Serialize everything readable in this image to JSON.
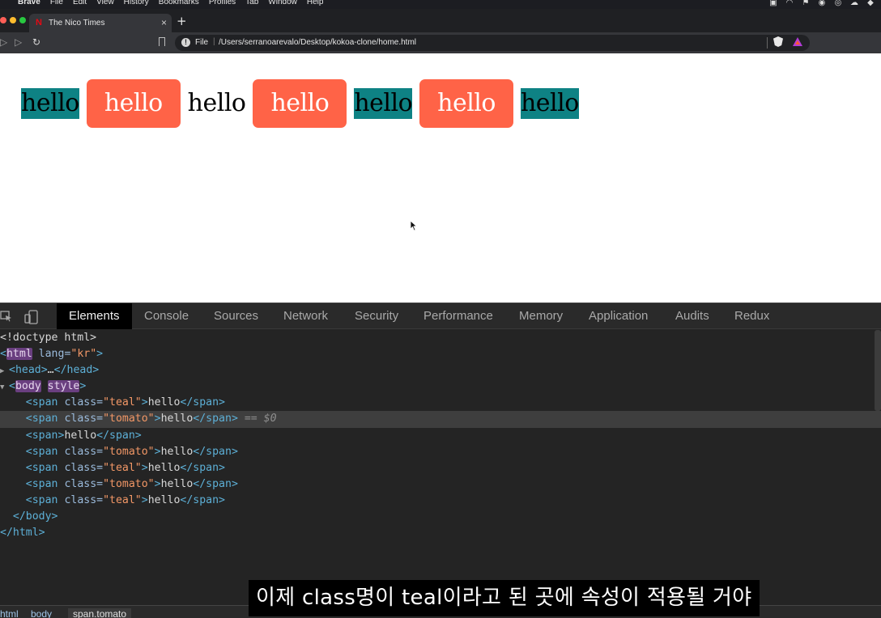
{
  "menubar": {
    "app": "Brave",
    "items": [
      "File",
      "Edit",
      "View",
      "History",
      "Bookmarks",
      "Profiles",
      "Tab",
      "Window",
      "Help"
    ]
  },
  "browser": {
    "tab_title": "The Nico Times",
    "tab_favicon": "N",
    "new_tab": "+",
    "url_scheme": "File",
    "url_path": "/Users/serranoarevalo/Desktop/kokoa-clone/home.html"
  },
  "page": {
    "words": [
      {
        "text": "hello",
        "class": "teal"
      },
      {
        "text": "hello",
        "class": "tomato"
      },
      {
        "text": "hello",
        "class": "plain"
      },
      {
        "text": "hello",
        "class": "tomato"
      },
      {
        "text": "hello",
        "class": "teal"
      },
      {
        "text": "hello",
        "class": "tomato"
      },
      {
        "text": "hello",
        "class": "teal"
      }
    ]
  },
  "devtools": {
    "tabs": [
      "Elements",
      "Console",
      "Sources",
      "Network",
      "Security",
      "Performance",
      "Memory",
      "Application",
      "Audits",
      "Redux"
    ],
    "active_tab": "Elements",
    "dom": {
      "doctype": "<!doctype html>",
      "html_tag": "html",
      "html_attr": "lang",
      "html_val": "\"kr\"",
      "head": "head",
      "head_ellipsis": "…",
      "body_tag": "body",
      "body_attr": "style",
      "span_tag": "span",
      "class_attr": "class",
      "children": [
        {
          "cls": "\"teal\"",
          "text": "hello"
        },
        {
          "cls": "\"tomato\"",
          "text": "hello"
        },
        {
          "cls": "",
          "text": "hello"
        },
        {
          "cls": "\"tomato\"",
          "text": "hello"
        },
        {
          "cls": "\"teal\"",
          "text": "hello"
        },
        {
          "cls": "\"tomato\"",
          "text": "hello"
        },
        {
          "cls": "\"teal\"",
          "text": "hello"
        }
      ],
      "selected_marker": " == $0",
      "body_close": "body",
      "html_close": "html"
    },
    "breadcrumbs": [
      "html",
      "body",
      "span.tomato"
    ]
  },
  "subtitle": "이제 class명이 teal이라고 된 곳에 속성이 적용될 거야",
  "colors": {
    "teal": "#0e8284",
    "tomato": "#ff6347",
    "traffic_red": "#ff5f57",
    "traffic_yellow": "#febc2e",
    "traffic_green": "#28c840"
  }
}
